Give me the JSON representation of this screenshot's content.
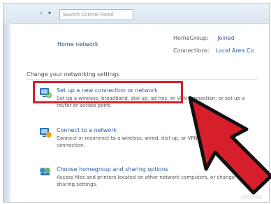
{
  "toolbar": {
    "back_icon": "chevron-left-icon",
    "forward_icon": "chevron-down-icon",
    "search_placeholder": "Search Control Panel"
  },
  "network_summary": {
    "name": "Home network",
    "homegroup_label": "HomeGroup:",
    "homegroup_value": "Joined",
    "connections_label": "Connections:",
    "connections_value": "Local Area Co"
  },
  "section_title": "Change your networking settings",
  "tasks": [
    {
      "title": "Set up a new connection or network",
      "description_line1": "Set up a wireless, broadband, dial-up, ad hoc, or VPN connection; or set up a",
      "description_line2": "router or access point.",
      "icon": "network-setup-icon"
    },
    {
      "title": "Connect to a network",
      "description_line1": "Connect or reconnect to a wireless, wired, dial-up, or VPN network",
      "description_line2": "connection.",
      "icon": "network-connect-icon"
    },
    {
      "title": "Choose homegroup and sharing options",
      "description_line1": "Access files and printers located on other network computers, or change",
      "description_line2": "sharing settings.",
      "icon": "homegroup-icon"
    }
  ],
  "colors": {
    "highlight": "#d61f2b",
    "link": "#2a55a2",
    "arrow": "#d61f2b"
  }
}
